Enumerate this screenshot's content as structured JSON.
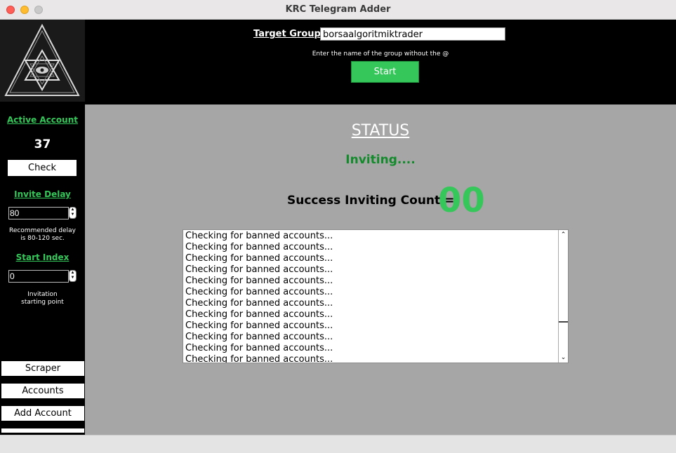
{
  "window": {
    "title": "KRC Telegram Adder"
  },
  "header": {
    "target_group_label": "Target Group:",
    "target_group_value": "borsaalgoritmiktrader",
    "hint": "Enter the name of the group without the @",
    "start_label": "Start"
  },
  "sidebar": {
    "active_account_title": "Active Account",
    "active_account_count": "37",
    "check_label": "Check",
    "invite_delay_title": "Invite Delay",
    "invite_delay_value": "80",
    "invite_delay_note_1": "Recommended delay",
    "invite_delay_note_2": "is 80-120 sec.",
    "start_index_title": "Start Index",
    "start_index_value": "0",
    "start_index_note_1": "Invitation",
    "start_index_note_2": "starting point",
    "nav": [
      "Scraper",
      "Accounts",
      "Add Account"
    ]
  },
  "main": {
    "status_title": "STATUS",
    "status_text": "Inviting....",
    "success_label": "Success Inviting Count =",
    "success_value": "00"
  },
  "log": {
    "lines": [
      "Checking for banned accounts...",
      "Checking for banned accounts...",
      "Checking for banned accounts...",
      "Checking for banned accounts...",
      "Checking for banned accounts...",
      "Checking for banned accounts...",
      "Checking for banned accounts...",
      "Checking for banned accounts...",
      "Checking for banned accounts...",
      "Checking for banned accounts...",
      "Checking for banned accounts...",
      "Checking for banned accounts..."
    ]
  },
  "colors": {
    "accent_green": "#35c759",
    "status_green": "#138a2c",
    "panel_gray": "#a6a6a6"
  }
}
